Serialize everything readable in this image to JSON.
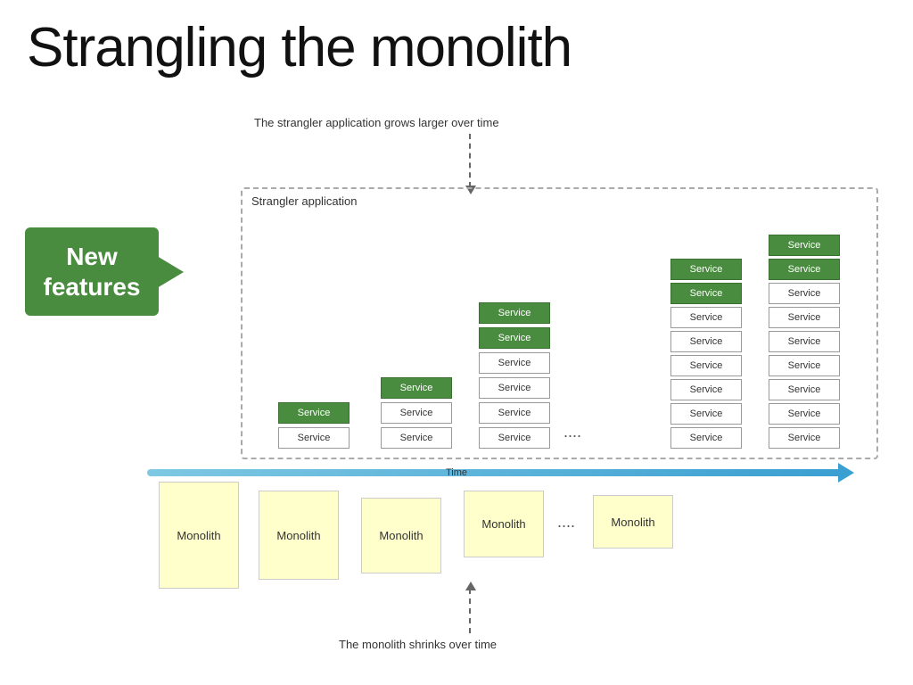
{
  "title": "Strangling the monolith",
  "subtitle": "The strangler application grows larger over time",
  "strangler_label": "Strangler application",
  "new_features": "New\nfeatures",
  "time_label": "Time",
  "bottom_label": "The monolith shrinks over time",
  "service_label": "Service",
  "monolith_label": "Monolith",
  "ellipsis": "....",
  "colors": {
    "green": "#4a8c3f",
    "outline_border": "#999",
    "monolith_bg": "#ffffcc",
    "arrow_blue": "#3a9fd1"
  }
}
